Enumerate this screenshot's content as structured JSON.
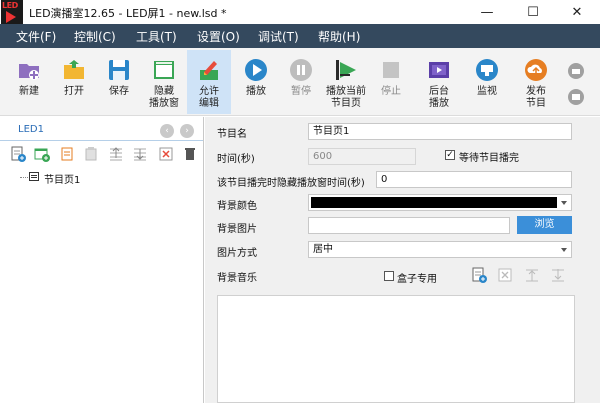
{
  "window": {
    "title": "LED演播室12.65 - LED屏1 - new.lsd *",
    "minimize": "—",
    "maximize": "☐",
    "close": "✕",
    "logo_text": "LED"
  },
  "menu": [
    "文件(F)",
    "控制(C)",
    "工具(T)",
    "设置(O)",
    "调试(T)",
    "帮助(H)"
  ],
  "toolbar": {
    "new": "新建",
    "open": "打开",
    "save": "保存",
    "hide_player_l1": "隐藏",
    "hide_player_l2": "播放窗",
    "allow_edit_l1": "允许",
    "allow_edit_l2": "编辑",
    "play": "播放",
    "pause": "暂停",
    "play_current_l1": "播放当前",
    "play_current_l2": "节目页",
    "stop": "停止",
    "background_l1": "后台",
    "background_l2": "播放",
    "monitor": "监视",
    "publish_l1": "发布",
    "publish_l2": "节目"
  },
  "left_panel": {
    "screen_name": "LED1",
    "nav_prev": "‹",
    "nav_next": "›",
    "tree_item": "节目页1"
  },
  "form": {
    "program_name_label": "节目名",
    "program_name_value": "节目页1",
    "time_label": "时间(秒)",
    "time_value": "600",
    "wait_label": "等待节目播完",
    "wait_checked": "✓",
    "hide_after_label": "该节目播完时隐藏播放窗时间(秒)",
    "hide_after_value": "0",
    "bg_color_label": "背景颜色",
    "bg_color_value": "#000000",
    "bg_image_label": "背景图片",
    "bg_image_value": "",
    "browse": "浏览",
    "image_mode_label": "图片方式",
    "image_mode_value": "居中",
    "bg_music_label": "背景音乐",
    "box_only_label": "盒子专用"
  },
  "colors": {
    "menubar": "#34495e",
    "accent": "#3b8fd9",
    "active_tool": "#cfe3f7"
  }
}
